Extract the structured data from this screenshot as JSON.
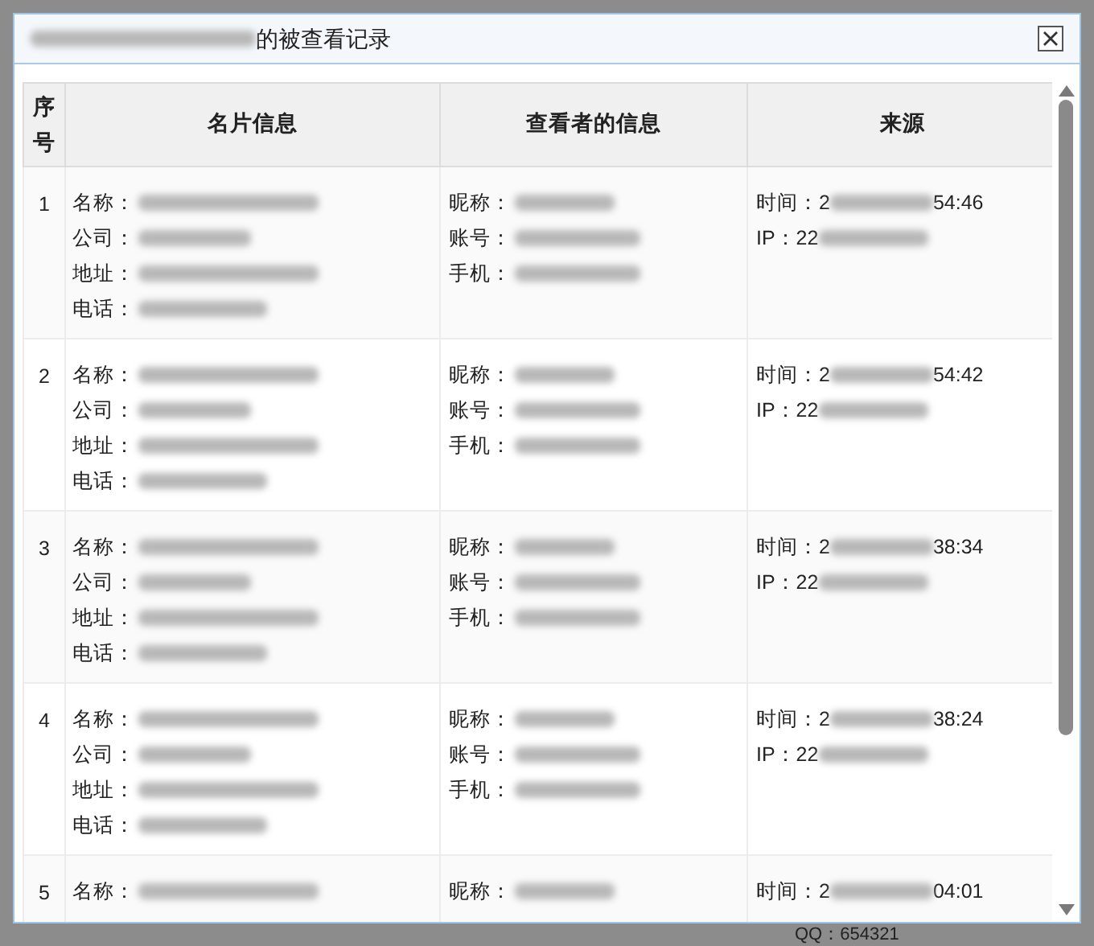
{
  "dialog": {
    "title": "的被查看记录"
  },
  "table": {
    "columns": [
      "序号",
      "名片信息",
      "查看者的信息",
      "来源"
    ],
    "rows": [
      {
        "index": "1",
        "card": [
          "名称：",
          "公司：",
          "地址：",
          "电话："
        ],
        "viewer": [
          "昵称：",
          "账号：",
          "手机："
        ],
        "time_prefix": "时间：2",
        "time_suffix": "54:46",
        "ip_prefix": "IP：22"
      },
      {
        "index": "2",
        "card": [
          "名称：",
          "公司：",
          "地址：",
          "电话："
        ],
        "viewer": [
          "昵称：",
          "账号：",
          "手机："
        ],
        "time_prefix": "时间：2",
        "time_suffix": "54:42",
        "ip_prefix": "IP：22"
      },
      {
        "index": "3",
        "card": [
          "名称：",
          "公司：",
          "地址：",
          "电话："
        ],
        "viewer": [
          "昵称：",
          "账号：",
          "手机："
        ],
        "time_prefix": "时间：2",
        "time_suffix": "38:34",
        "ip_prefix": "IP：22"
      },
      {
        "index": "4",
        "card": [
          "名称：",
          "公司：",
          "地址：",
          "电话："
        ],
        "viewer": [
          "昵称：",
          "账号：",
          "手机："
        ],
        "time_prefix": "时间：2",
        "time_suffix": "38:24",
        "ip_prefix": "IP：22"
      },
      {
        "index": "5",
        "card": [
          "名称："
        ],
        "viewer": [
          "昵称："
        ],
        "time_prefix": "时间：2",
        "time_suffix": "04:01"
      }
    ]
  },
  "background": {
    "text": "QQ：654321"
  }
}
